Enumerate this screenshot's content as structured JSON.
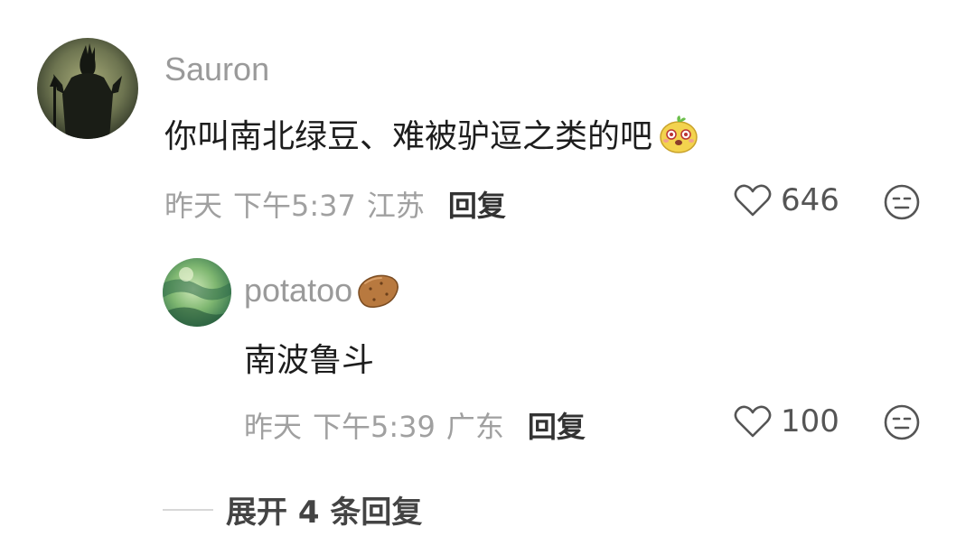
{
  "comments": [
    {
      "username": "Sauron",
      "text": "你叫南北绿豆、难被驴逗之类的吧",
      "text_emoji": "face-emoji",
      "date": "昨天",
      "time": "下午5:37",
      "location": "江苏",
      "reply_label": "回复",
      "likes": "646",
      "avatar_icon": "dark-lord-avatar",
      "replies": [
        {
          "username": "potatoo",
          "username_emoji": "potato-emoji",
          "text": "南波鲁斗",
          "date": "昨天",
          "time": "下午5:39",
          "location": "广东",
          "reply_label": "回复",
          "likes": "100",
          "avatar_icon": "green-texture-avatar"
        }
      ]
    }
  ],
  "expand_replies_label": "展开 4 条回复",
  "colors": {
    "meta_gray": "#a0a0a0",
    "username_gray": "#9a9a9a",
    "text_dark": "#1d1d1d"
  }
}
